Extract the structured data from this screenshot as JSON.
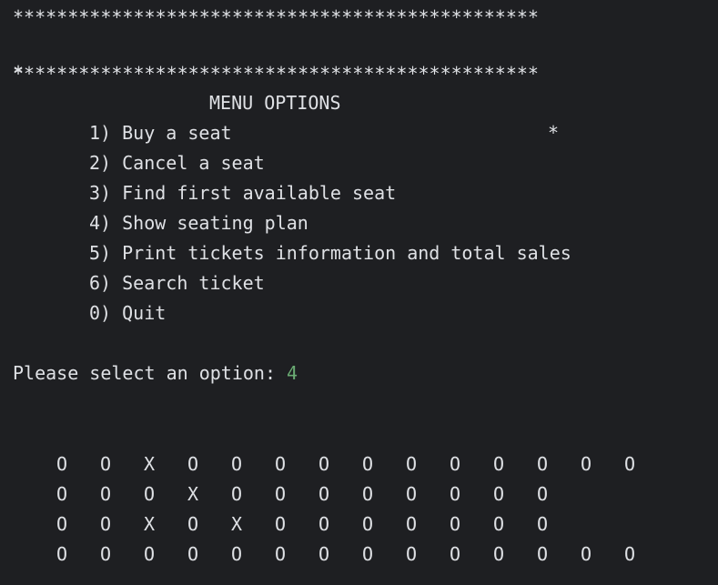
{
  "header": {
    "border": "************************************************",
    "left_star": "*",
    "title": "MENU OPTIONS",
    "right_star": "*"
  },
  "menu": {
    "items": [
      "1) Buy a seat",
      "2) Cancel a seat",
      "3) Find first available seat",
      "4) Show seating plan",
      "5) Print tickets information and total sales",
      "6) Search ticket",
      "0) Quit"
    ]
  },
  "prompt": {
    "label": "Please select an option: ",
    "value": "4"
  },
  "seating_plan": {
    "rows": [
      [
        "O",
        "O",
        "X",
        "O",
        "O",
        "O",
        "O",
        "O",
        "O",
        "O",
        "O",
        "O",
        "O",
        "O"
      ],
      [
        "O",
        "O",
        "O",
        "X",
        "O",
        "O",
        "O",
        "O",
        "O",
        "O",
        "O",
        "O"
      ],
      [
        "O",
        "O",
        "X",
        "O",
        "X",
        "O",
        "O",
        "O",
        "O",
        "O",
        "O",
        "O"
      ],
      [
        "O",
        "O",
        "O",
        "O",
        "O",
        "O",
        "O",
        "O",
        "O",
        "O",
        "O",
        "O",
        "O",
        "O"
      ]
    ]
  }
}
